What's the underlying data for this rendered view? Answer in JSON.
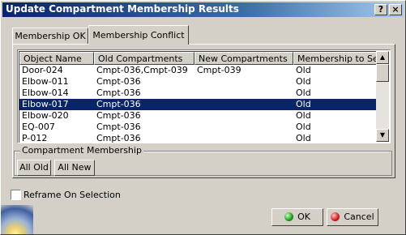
{
  "window": {
    "title": "Update Compartment Membership Results",
    "help_label": "?",
    "close_label": "×"
  },
  "tabs": [
    {
      "label": "Membership OK",
      "active": false
    },
    {
      "label": "Membership Conflict",
      "active": true
    }
  ],
  "table": {
    "columns": [
      "Object Name",
      "Old Compartments",
      "New Compartments",
      "Membership to Set"
    ],
    "rows": [
      [
        "Door-024",
        "Cmpt-036,Cmpt-039",
        "Cmpt-039",
        "Old"
      ],
      [
        "Elbow-011",
        "Cmpt-036",
        "",
        "Old"
      ],
      [
        "Elbow-014",
        "Cmpt-036",
        "",
        "Old"
      ],
      [
        "Elbow-017",
        "Cmpt-036",
        "",
        "Old"
      ],
      [
        "Elbow-020",
        "Cmpt-036",
        "",
        "Old"
      ],
      [
        "EQ-007",
        "Cmpt-036",
        "",
        "Old"
      ],
      [
        "P-012",
        "Cmpt-036",
        "",
        "Old"
      ]
    ],
    "selected_row": 3,
    "selected_color": "#0a246a"
  },
  "compartment_membership": {
    "label": "Compartment Membership",
    "all_old_label": "All Old",
    "all_new_label": "All New"
  },
  "reframe": {
    "label": "Reframe On Selection",
    "checked": false
  },
  "footer": {
    "ok_label": "OK",
    "ok_icon": "green-ok-icon",
    "cancel_label": "Cancel",
    "cancel_icon": "red-cancel-icon"
  }
}
